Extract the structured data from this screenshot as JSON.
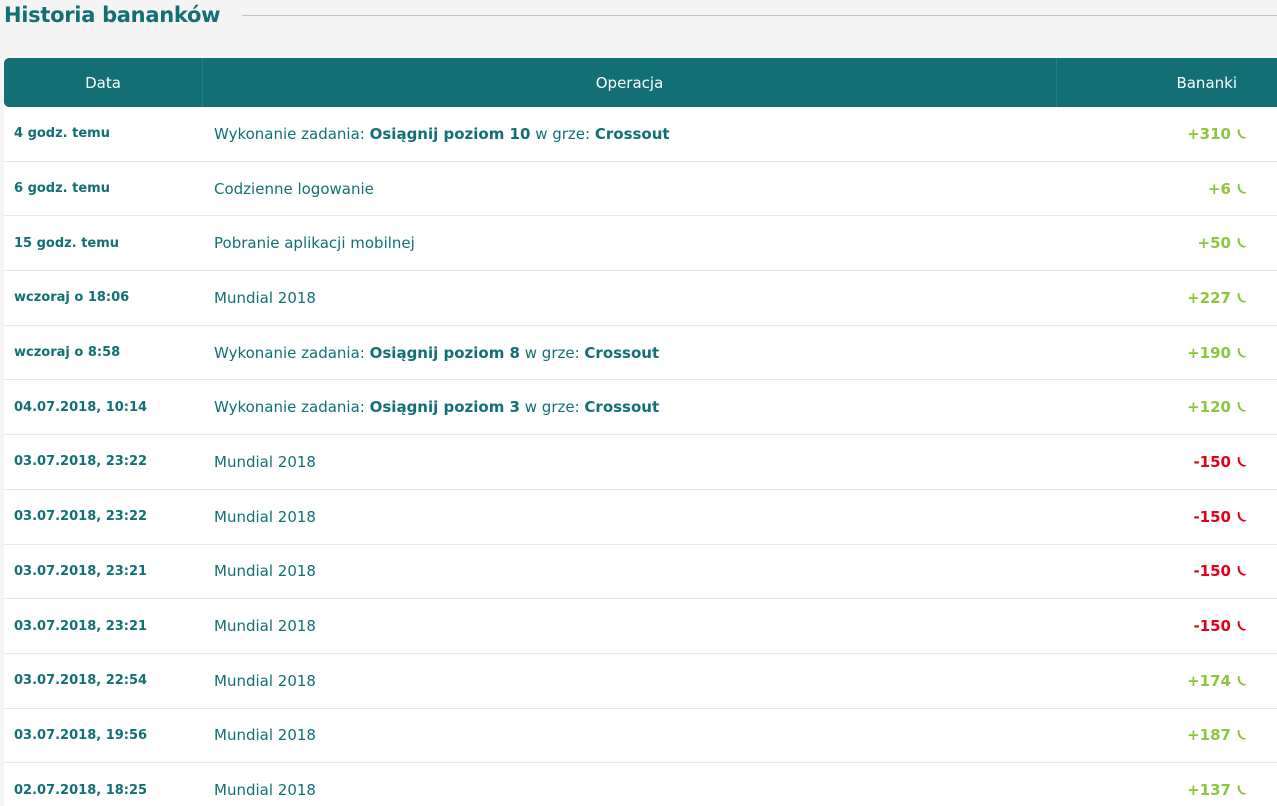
{
  "page": {
    "title": "Historia bananków"
  },
  "table": {
    "columns": [
      "Data",
      "Operacja",
      "Bananki"
    ],
    "rows": [
      {
        "date": "4 godz. temu",
        "op": {
          "prefix": "Wykonanie zadania: ",
          "task": "Osiągnij poziom 10",
          "mid": " w grze: ",
          "game": "Crossout"
        },
        "amount": "+310",
        "sign": "pos"
      },
      {
        "date": "6 godz. temu",
        "op": {
          "text": "Codzienne logowanie"
        },
        "amount": "+6",
        "sign": "pos"
      },
      {
        "date": "15 godz. temu",
        "op": {
          "text": "Pobranie aplikacji mobilnej"
        },
        "amount": "+50",
        "sign": "pos"
      },
      {
        "date": "wczoraj o 18:06",
        "op": {
          "text": "Mundial 2018"
        },
        "amount": "+227",
        "sign": "pos"
      },
      {
        "date": "wczoraj o 8:58",
        "op": {
          "prefix": "Wykonanie zadania: ",
          "task": "Osiągnij poziom 8",
          "mid": " w grze: ",
          "game": "Crossout"
        },
        "amount": "+190",
        "sign": "pos"
      },
      {
        "date": "04.07.2018, 10:14",
        "op": {
          "prefix": "Wykonanie zadania: ",
          "task": "Osiągnij poziom 3",
          "mid": " w grze: ",
          "game": "Crossout"
        },
        "amount": "+120",
        "sign": "pos"
      },
      {
        "date": "03.07.2018, 23:22",
        "op": {
          "text": "Mundial 2018"
        },
        "amount": "-150",
        "sign": "neg"
      },
      {
        "date": "03.07.2018, 23:22",
        "op": {
          "text": "Mundial 2018"
        },
        "amount": "-150",
        "sign": "neg"
      },
      {
        "date": "03.07.2018, 23:21",
        "op": {
          "text": "Mundial 2018"
        },
        "amount": "-150",
        "sign": "neg"
      },
      {
        "date": "03.07.2018, 23:21",
        "op": {
          "text": "Mundial 2018"
        },
        "amount": "-150",
        "sign": "neg"
      },
      {
        "date": "03.07.2018, 22:54",
        "op": {
          "text": "Mundial 2018"
        },
        "amount": "+174",
        "sign": "pos"
      },
      {
        "date": "03.07.2018, 19:56",
        "op": {
          "text": "Mundial 2018"
        },
        "amount": "+187",
        "sign": "pos"
      },
      {
        "date": "02.07.2018, 18:25",
        "op": {
          "text": "Mundial 2018"
        },
        "amount": "+137",
        "sign": "pos"
      }
    ]
  },
  "icons": {
    "amount_icon": "banana-icon"
  },
  "colors": {
    "primary": "#127074",
    "positive": "#8cc63e",
    "negative": "#e2001a"
  }
}
